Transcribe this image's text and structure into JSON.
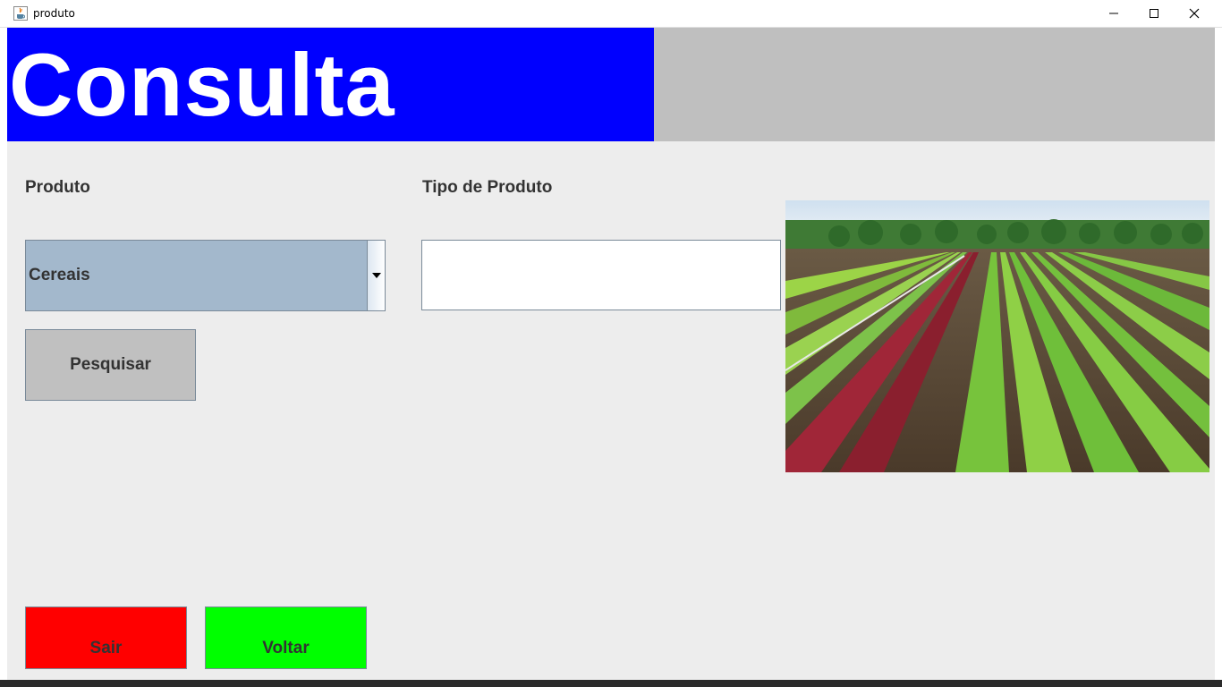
{
  "window": {
    "title": "produto",
    "app_icon": "java-cup-icon",
    "controls": [
      "minimize-icon",
      "maximize-icon",
      "close-icon"
    ]
  },
  "header": {
    "title": "Consulta",
    "title_color": "#ffffff",
    "banner_color": "#0000ff",
    "side_color": "#bfbfbf"
  },
  "form": {
    "produto_label": "Produto",
    "tipo_label": "Tipo de Produto",
    "produto_select": {
      "selected": "Cereais"
    },
    "tipo_input": {
      "value": ""
    },
    "pesquisar_label": "Pesquisar"
  },
  "image": {
    "subject": "vegetable-field-photo"
  },
  "footer": {
    "sair_label": "Sair",
    "sair_color": "#ff0000",
    "voltar_label": "Voltar",
    "voltar_color": "#00ff00"
  }
}
